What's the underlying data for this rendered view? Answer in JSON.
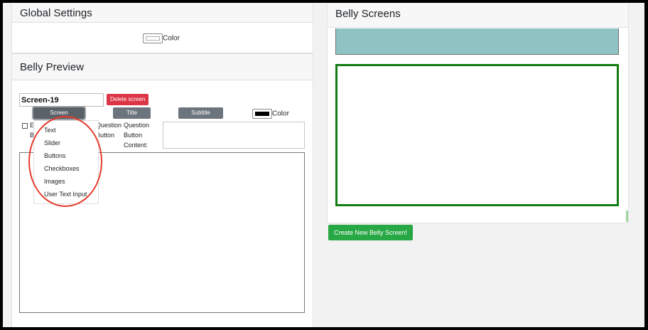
{
  "global_settings": {
    "title": "Global Settings",
    "color_label": "Color"
  },
  "belly_preview": {
    "title": "Belly Preview",
    "screen_name_value": "Screen-19",
    "delete_label": "Delete screen",
    "screen_layout_label": "Screen Layout",
    "title_font_label": "Title Font",
    "subtitle_font_label": "Subtitle Font",
    "color_label": "Color",
    "checkbox_label_partial": "E",
    "checkbox_label_partial_2": "B",
    "question_label_1": "Question",
    "question_label_2": "Button",
    "question_content_1": "Question",
    "question_content_2": "Button",
    "question_content_3": "Content:",
    "layout_options": [
      "Text",
      "Slider",
      "Buttons",
      "Checkboxes",
      "Images",
      "User Text Input"
    ]
  },
  "belly_screens": {
    "title": "Belly Screens",
    "create_label": "Create New Belly Screen!"
  },
  "colors": {
    "danger": "#dc3545",
    "secondary": "#6c757d",
    "success": "#28a745",
    "screen_border": "#127c12",
    "teal": "#8fc3c3",
    "annotation": "#e53b2c"
  }
}
